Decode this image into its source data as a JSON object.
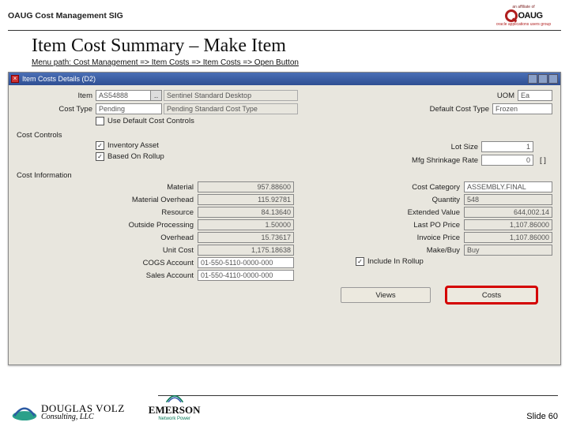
{
  "slide": {
    "header": "OAUG Cost Management SIG",
    "title": "Item Cost Summary – Make Item",
    "menu_path": "Menu path:  Cost Management => Item Costs  => Item Costs => Open Button",
    "number": "Slide 60"
  },
  "window": {
    "title": "Item Costs Details (D2)"
  },
  "form": {
    "item_lbl": "Item",
    "item_value": "AS54888",
    "item_desc": "Sentinel Standard Desktop",
    "uom_lbl": "UOM",
    "uom_value": "Ea",
    "cost_type_lbl": "Cost Type",
    "cost_type_value": "Pending",
    "cost_type_desc": "Pending Standard Cost Type",
    "default_cost_type_lbl": "Default Cost Type",
    "default_cost_type_value": "Frozen",
    "use_def_controls_lbl": "Use Default Cost Controls"
  },
  "cost_controls": {
    "section": "Cost Controls",
    "inv_asset": "Inventory Asset",
    "based_on_rollup": "Based On Rollup",
    "lot_size_lbl": "Lot Size",
    "lot_size_val": "1",
    "shrink_lbl": "Mfg Shrinkage Rate",
    "shrink_val": "0",
    "flex": "[   ]"
  },
  "cost_info": {
    "section": "Cost Information",
    "material_lbl": "Material",
    "material_val": "957.88600",
    "mo_lbl": "Material Overhead",
    "mo_val": "115.92781",
    "resource_lbl": "Resource",
    "resource_val": "84.13640",
    "osp_lbl": "Outside Processing",
    "osp_val": "1.50000",
    "oh_lbl": "Overhead",
    "oh_val": "15.73617",
    "unit_lbl": "Unit Cost",
    "unit_val": "1,175.18638",
    "cogs_lbl": "COGS Account",
    "cogs_val": "01-550-5110-0000-000",
    "sales_lbl": "Sales Account",
    "sales_val": "01-550-4110-0000-000",
    "cat_lbl": "Cost Category",
    "cat_val": "ASSEMBLY.FINAL",
    "qty_lbl": "Quantity",
    "qty_val": "548",
    "ext_lbl": "Extended Value",
    "ext_val": "644,002.14",
    "po_lbl": "Last PO Price",
    "po_val": "1,107.86000",
    "inv_lbl": "Invoice Price",
    "inv_val": "1,107.86000",
    "makebuy_lbl": "Make/Buy",
    "makebuy_val": "Buy",
    "include_lbl": "Include In Rollup"
  },
  "buttons": {
    "views": "Views",
    "costs": "Costs"
  },
  "logos": {
    "oaug_top": "an affiliate of",
    "oaug_text": "OAUG",
    "oaug_sub": "oracle applications users group",
    "dv_big": "DOUGLAS VOLZ",
    "dv_small": "Consulting, LLC",
    "em_text": "EMERSON",
    "em_sub": "Network Power"
  }
}
